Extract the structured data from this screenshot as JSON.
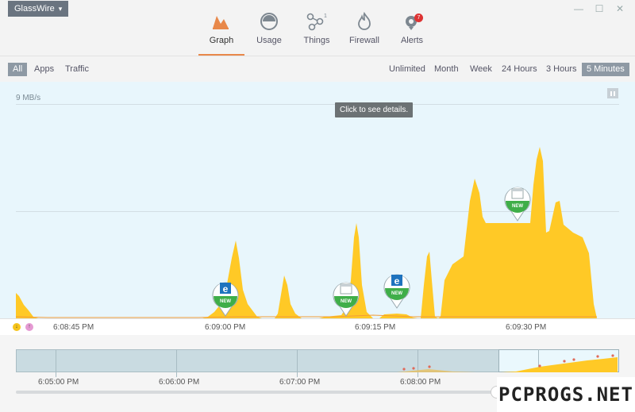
{
  "app": {
    "name": "GlassWire"
  },
  "window_controls": {
    "minimize": "—",
    "maximize": "☐",
    "close": "✕"
  },
  "tabs": [
    {
      "label": "Graph",
      "icon": "graph-icon",
      "active": true
    },
    {
      "label": "Usage",
      "icon": "usage-icon"
    },
    {
      "label": "Things",
      "icon": "things-icon",
      "superscript": "1"
    },
    {
      "label": "Firewall",
      "icon": "firewall-icon"
    },
    {
      "label": "Alerts",
      "icon": "alerts-icon",
      "badge": "7"
    }
  ],
  "filters": {
    "left": [
      {
        "label": "All",
        "active": true
      },
      {
        "label": "Apps"
      },
      {
        "label": "Traffic"
      }
    ],
    "right": [
      {
        "label": "Unlimited"
      },
      {
        "label": "Month"
      },
      {
        "label": "Week"
      },
      {
        "label": "24 Hours"
      },
      {
        "label": "3 Hours"
      },
      {
        "label": "5 Minutes",
        "active": true
      }
    ]
  },
  "graph": {
    "scale_label": "9 MB/s",
    "tooltip": "Click to see details.",
    "colors": {
      "traffic": "#ffc926",
      "traffic_dark": "#f2b81a",
      "background": "#e8f6fc",
      "new_badge": "#3fae49"
    },
    "pins": [
      {
        "app": "edge",
        "icon": "edge-icon",
        "label": "NEW"
      },
      {
        "app": "generic",
        "icon": "window-icon",
        "label": "NEW"
      },
      {
        "app": "edge",
        "icon": "edge-icon",
        "label": "NEW"
      },
      {
        "app": "generic",
        "icon": "window-icon",
        "label": "NEW"
      }
    ]
  },
  "axis": {
    "download_icon": "arrow-down-icon",
    "upload_icon": "arrow-up-icon",
    "ticks": [
      "6:08:45 PM",
      "6:09:00 PM",
      "6:09:15 PM",
      "6:09:30 PM"
    ]
  },
  "timeline": {
    "ticks": [
      "6:05:00 PM",
      "6:06:00 PM",
      "6:07:00 PM",
      "6:08:00 PM"
    ]
  },
  "watermark": "PCPROGS.NET"
}
